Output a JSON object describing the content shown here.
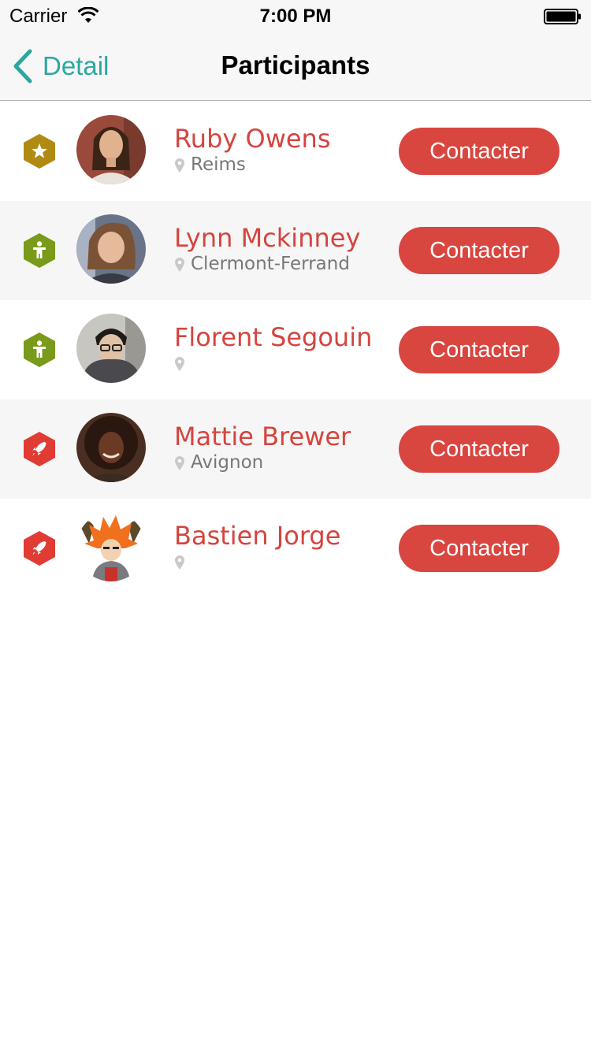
{
  "status_bar": {
    "carrier": "Carrier",
    "time": "7:00 PM"
  },
  "nav": {
    "back_label": "Detail",
    "title": "Participants"
  },
  "colors": {
    "accent_teal": "#2ba8a0",
    "name_red": "#d5443f",
    "button_red": "#d9453f",
    "badge_gold": "#b08a12",
    "badge_green": "#7a9a1a",
    "badge_red": "#e03c33"
  },
  "participants": [
    {
      "name": "Ruby Owens",
      "city": "Reims",
      "badge": "star-badge-icon",
      "button_label": "Contacter"
    },
    {
      "name": "Lynn Mckinney",
      "city": "Clermont-Ferrand",
      "badge": "person-badge-icon",
      "button_label": "Contacter"
    },
    {
      "name": "Florent Segouin",
      "city": "",
      "badge": "person-badge-icon",
      "button_label": "Contacter"
    },
    {
      "name": "Mattie Brewer",
      "city": "Avignon",
      "badge": "rocket-badge-icon",
      "button_label": "Contacter"
    },
    {
      "name": "Bastien Jorge",
      "city": "",
      "badge": "rocket-badge-icon",
      "button_label": "Contacter"
    }
  ]
}
